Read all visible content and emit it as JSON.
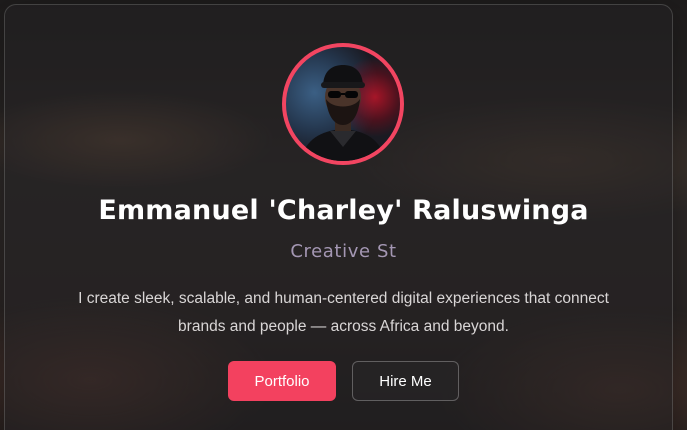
{
  "profile": {
    "name": "Emmanuel 'Charley' Raluswinga",
    "role": "Creative St",
    "bio": "I create sleek, scalable, and human-centered digital experiences that connect brands and people — across Africa and beyond.",
    "avatar_icon": "profile-photo"
  },
  "actions": {
    "portfolio_label": "Portfolio",
    "hire_label": "Hire Me"
  },
  "colors": {
    "accent": "#f3415f",
    "role_text": "#a497b3"
  }
}
